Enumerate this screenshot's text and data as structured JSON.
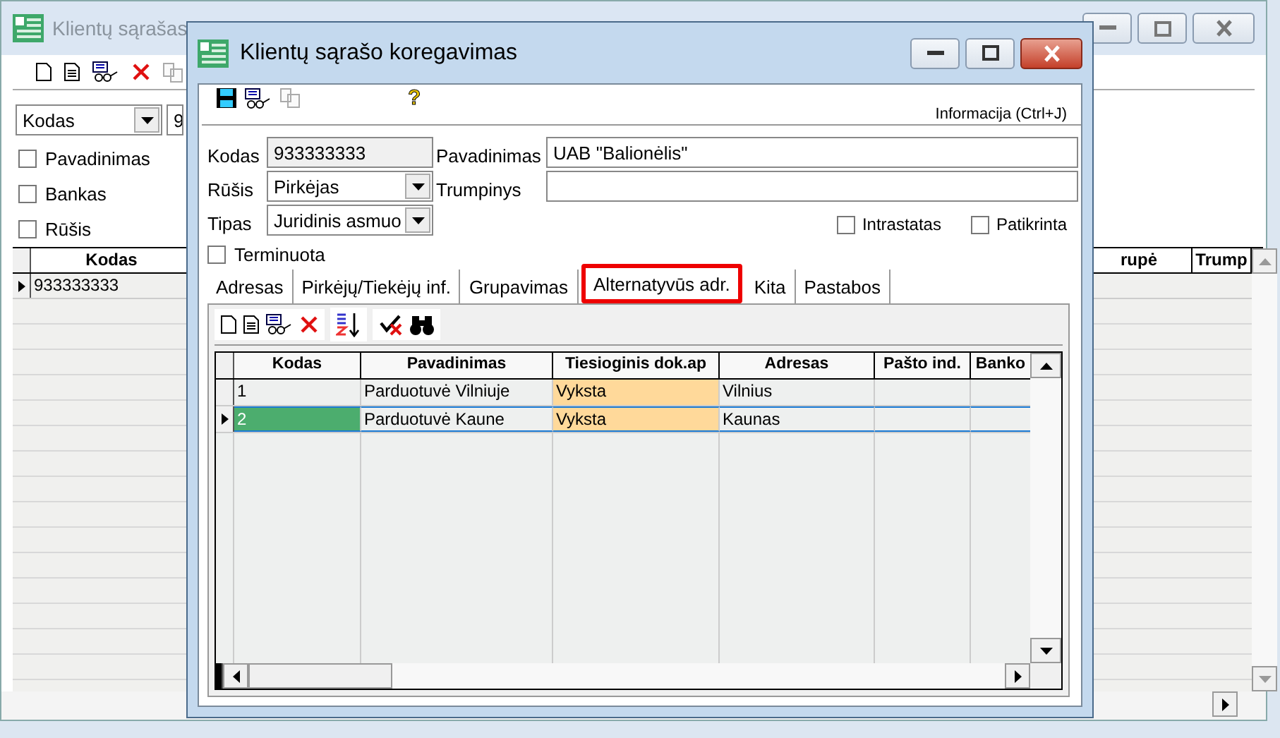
{
  "background_window": {
    "title": "Klientų sąrašas",
    "filter_field": "Kodas",
    "filter_value": "9",
    "checkboxes": [
      {
        "label": "Pavadinimas",
        "checked": false
      },
      {
        "label": "Bankas",
        "checked": false
      },
      {
        "label": "Rūšis",
        "checked": false
      }
    ],
    "table": {
      "columns": [
        "Kodas",
        "rupė",
        "Trump"
      ],
      "rows": [
        {
          "cells": [
            "933333333"
          ],
          "current": true
        }
      ]
    }
  },
  "dialog": {
    "title": "Klientų sąrašo koregavimas",
    "help_icon": "?",
    "info_link": "Informacija (Ctrl+J)",
    "kodas": {
      "label": "Kodas",
      "value": "933333333"
    },
    "pavadinimas": {
      "label": "Pavadinimas",
      "value": "UAB \"Balionėlis\""
    },
    "rusis": {
      "label": "Rūšis",
      "value": "Pirkėjas"
    },
    "trumpinys": {
      "label": "Trumpinys"
    },
    "tipas": {
      "label": "Tipas",
      "value": "Juridinis asmuo"
    },
    "checkboxes": [
      {
        "label": "Intrastatas",
        "checked": false
      },
      {
        "label": "Patikrinta",
        "checked": false
      }
    ],
    "terminuota": {
      "label": "Terminuota",
      "checked": false
    },
    "tabs": [
      {
        "label": "Adresas",
        "selected": false
      },
      {
        "label": "Pirkėjų/Tiekėjų inf.",
        "selected": false
      },
      {
        "label": "Grupavimas",
        "selected": false
      },
      {
        "label": "Alternatyvūs adr.",
        "selected": true
      },
      {
        "label": "Kita",
        "selected": false
      },
      {
        "label": "Pastabos",
        "selected": false
      }
    ],
    "table": {
      "columns": [
        {
          "label": "Kodas",
          "highlighted": false
        },
        {
          "label": "Pavadinimas",
          "highlighted": false
        },
        {
          "label": "Tiesioginis dok.ap",
          "highlighted": true
        },
        {
          "label": "Adresas",
          "highlighted": false
        },
        {
          "label": "Pašto ind.",
          "highlighted": false
        },
        {
          "label": "Banko",
          "highlighted": false
        }
      ],
      "rows": [
        {
          "cells": [
            "1",
            "Parduotuvė Vilniuje",
            "Vyksta",
            "Vilnius"
          ],
          "selected": false
        },
        {
          "cells": [
            "2",
            "Parduotuvė Kaune",
            "Vyksta",
            "Kaunas"
          ],
          "selected": true
        }
      ]
    }
  }
}
